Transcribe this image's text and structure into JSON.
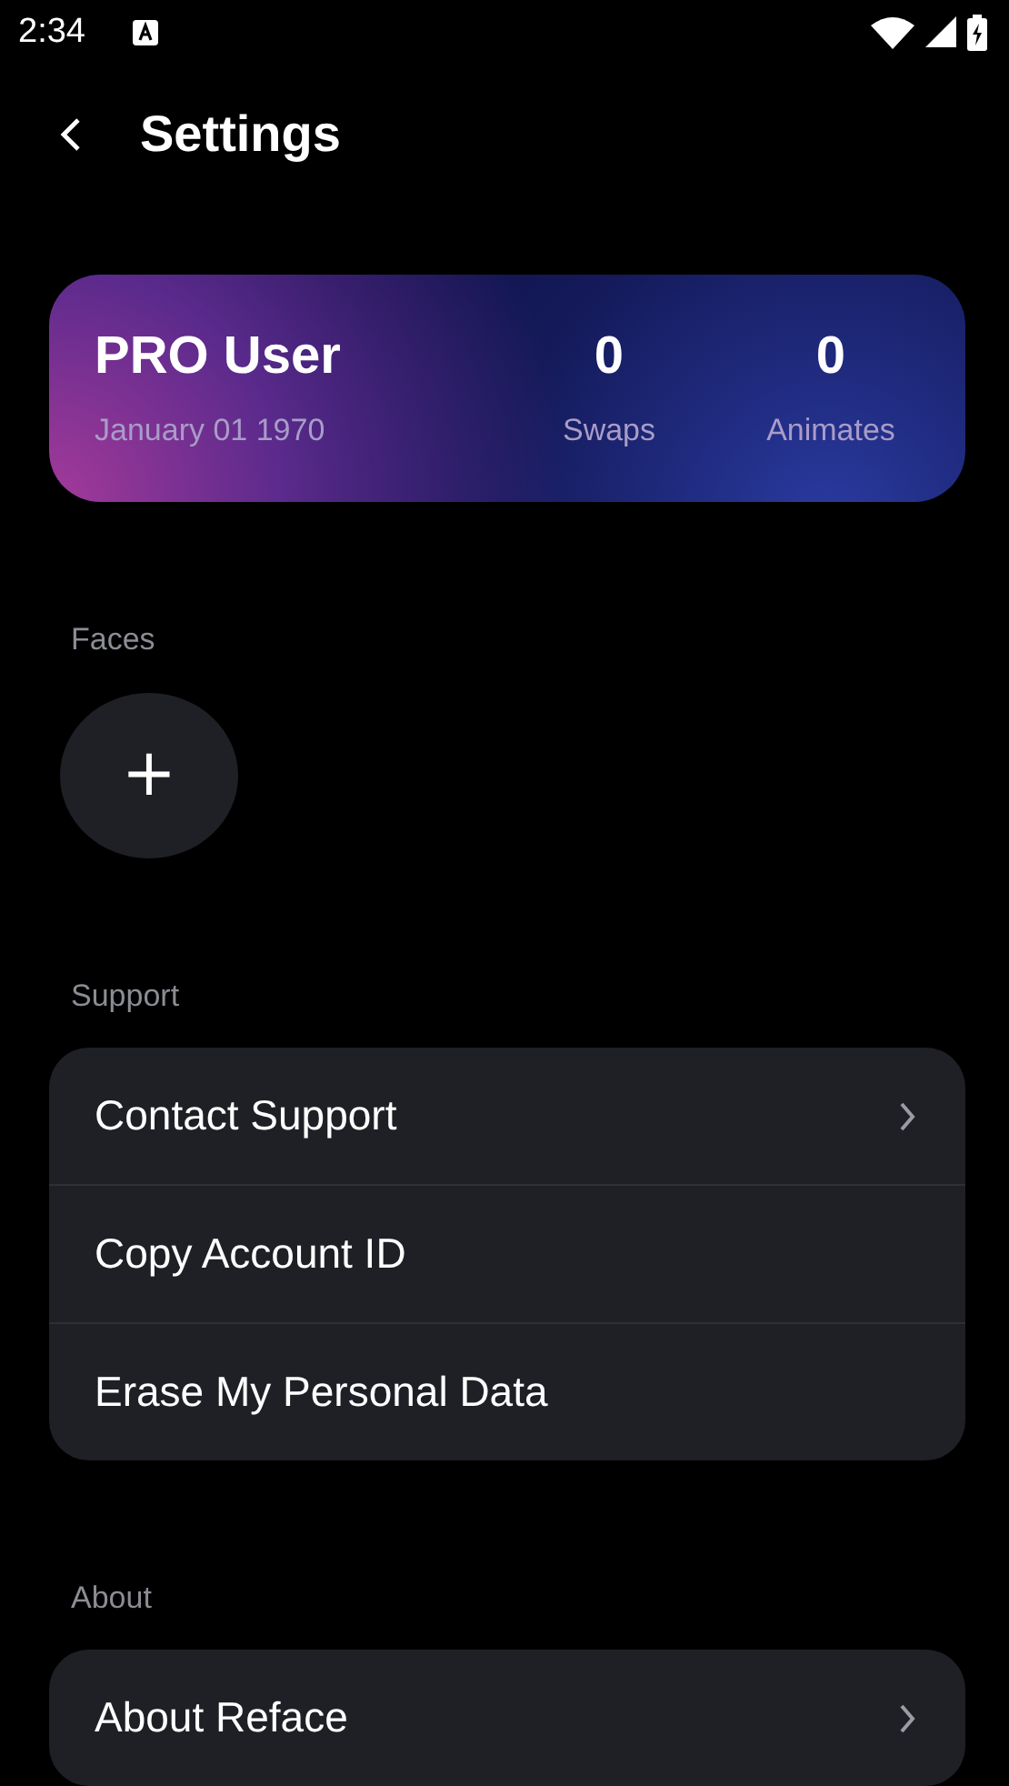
{
  "status_bar": {
    "time": "2:34"
  },
  "header": {
    "title": "Settings"
  },
  "profile": {
    "name": "PRO User",
    "date": "January 01 1970",
    "stats": [
      {
        "value": "0",
        "label": "Swaps"
      },
      {
        "value": "0",
        "label": "Animates"
      }
    ]
  },
  "faces": {
    "label": "Faces",
    "add_button": "+"
  },
  "sections": [
    {
      "label": "Support",
      "items": [
        {
          "label": "Contact Support",
          "chevron": true
        },
        {
          "label": "Copy Account ID",
          "chevron": false
        },
        {
          "label": "Erase My Personal Data",
          "chevron": false
        }
      ]
    },
    {
      "label": "About",
      "items": [
        {
          "label": "About Reface",
          "chevron": true
        }
      ]
    }
  ]
}
